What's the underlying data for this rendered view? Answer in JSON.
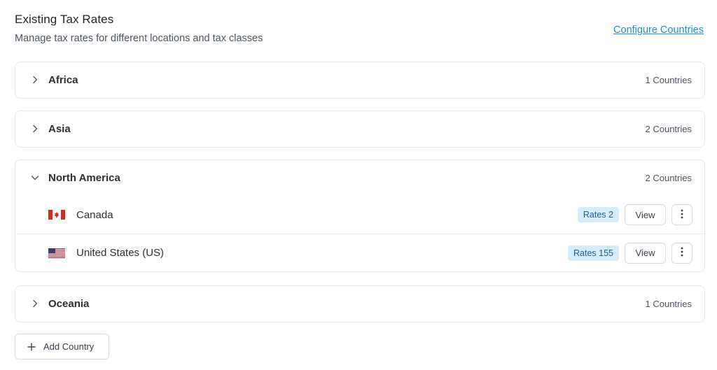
{
  "header": {
    "title": "Existing Tax Rates",
    "subtitle": "Manage tax rates for different locations and tax classes",
    "configure_link": "Configure Countries"
  },
  "regions": [
    {
      "name": "Africa",
      "count": "1 Countries",
      "expanded": false
    },
    {
      "name": "Asia",
      "count": "2 Countries",
      "expanded": false
    },
    {
      "name": "North America",
      "count": "2 Countries",
      "expanded": true,
      "countries": [
        {
          "name": "Canada",
          "flag": "canada-flag-icon",
          "rates": "Rates 2",
          "view_label": "View"
        },
        {
          "name": "United States (US)",
          "flag": "us-flag-icon",
          "rates": "Rates 155",
          "view_label": "View"
        }
      ]
    },
    {
      "name": "Oceania",
      "count": "1 Countries",
      "expanded": false
    }
  ],
  "add_country_label": "Add Country",
  "colors": {
    "link": "#1a8fd6",
    "badge_bg": "#d6ecfb",
    "badge_text": "#1b5e8f",
    "border": "#e5e7eb"
  }
}
